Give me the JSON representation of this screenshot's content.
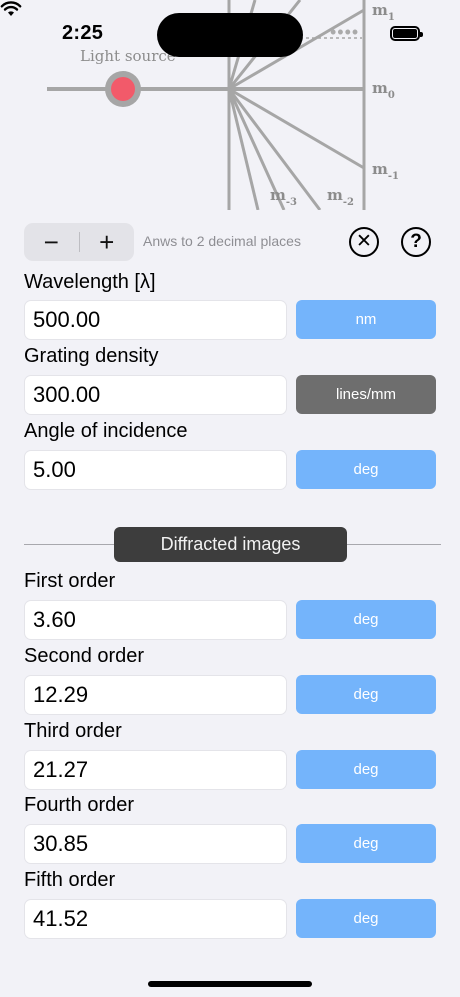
{
  "status_bar": {
    "time": "2:25",
    "extra_indicator": "••••"
  },
  "diagram": {
    "light_source_label": "Light source",
    "orders": [
      {
        "base": "m",
        "sub": "1"
      },
      {
        "base": "m",
        "sub": "0"
      },
      {
        "base": "m",
        "sub": "-1"
      },
      {
        "base": "m",
        "sub": "-2"
      },
      {
        "base": "m",
        "sub": "-3"
      }
    ],
    "colors": {
      "source": "#f25a6a",
      "lines": "#a6a6a6"
    }
  },
  "toolbar": {
    "minus_label": "−",
    "plus_label": "+",
    "hint": "Anws to 2 decimal places",
    "clear_label": "✕",
    "help_label": "?"
  },
  "inputs": [
    {
      "label": "Wavelength [λ]",
      "value": "500.00",
      "unit": "nm",
      "unit_style": "blue"
    },
    {
      "label": "Grating density",
      "value": "300.00",
      "unit": "lines/mm",
      "unit_style": "dark"
    },
    {
      "label": "Angle of incidence",
      "value": "5.00",
      "unit": "deg",
      "unit_style": "blue"
    }
  ],
  "section_title": "Diffracted images",
  "outputs": [
    {
      "label": "First order",
      "value": "3.60",
      "unit": "deg"
    },
    {
      "label": "Second order",
      "value": "12.29",
      "unit": "deg"
    },
    {
      "label": "Third order",
      "value": "21.27",
      "unit": "deg"
    },
    {
      "label": "Fourth order",
      "value": "30.85",
      "unit": "deg"
    },
    {
      "label": "Fifth order",
      "value": "41.52",
      "unit": "deg"
    }
  ],
  "colors": {
    "accent": "#74b4fb",
    "dark_button": "#6e6e6e",
    "section_bg": "#3d3d3d"
  }
}
